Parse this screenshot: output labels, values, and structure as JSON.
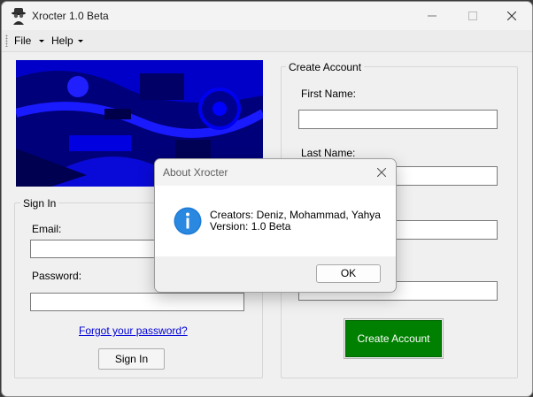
{
  "window": {
    "title": "Xrocter 1.0 Beta"
  },
  "menu": {
    "file_label": "File",
    "help_label": "Help"
  },
  "sign_in": {
    "group_title": "Sign In",
    "email_label": "Email:",
    "email_value": "",
    "password_label": "Password:",
    "password_value": "",
    "forgot_link": "Forgot your password?",
    "button_label": "Sign In"
  },
  "create_account": {
    "group_title": "Create Account",
    "first_name_label": "First Name:",
    "first_name_value": "",
    "last_name_label": "Last Name:",
    "last_name_value": "",
    "field3_value": "",
    "field4_value": "",
    "button_label": "Create Account"
  },
  "about_dialog": {
    "title": "About Xrocter",
    "line1": "Creators: Deniz, Mohammad, Yahya",
    "line2": "Version: 1.0 Beta",
    "ok_label": "OK"
  },
  "colors": {
    "create_button_bg": "#008000",
    "link": "#0000d8",
    "info_icon": "#1e7bd6",
    "banner": "#00007a"
  },
  "icons": [
    "spy-hat-icon",
    "minimize-icon",
    "maximize-icon",
    "close-icon",
    "chevron-down-icon",
    "info-icon"
  ]
}
